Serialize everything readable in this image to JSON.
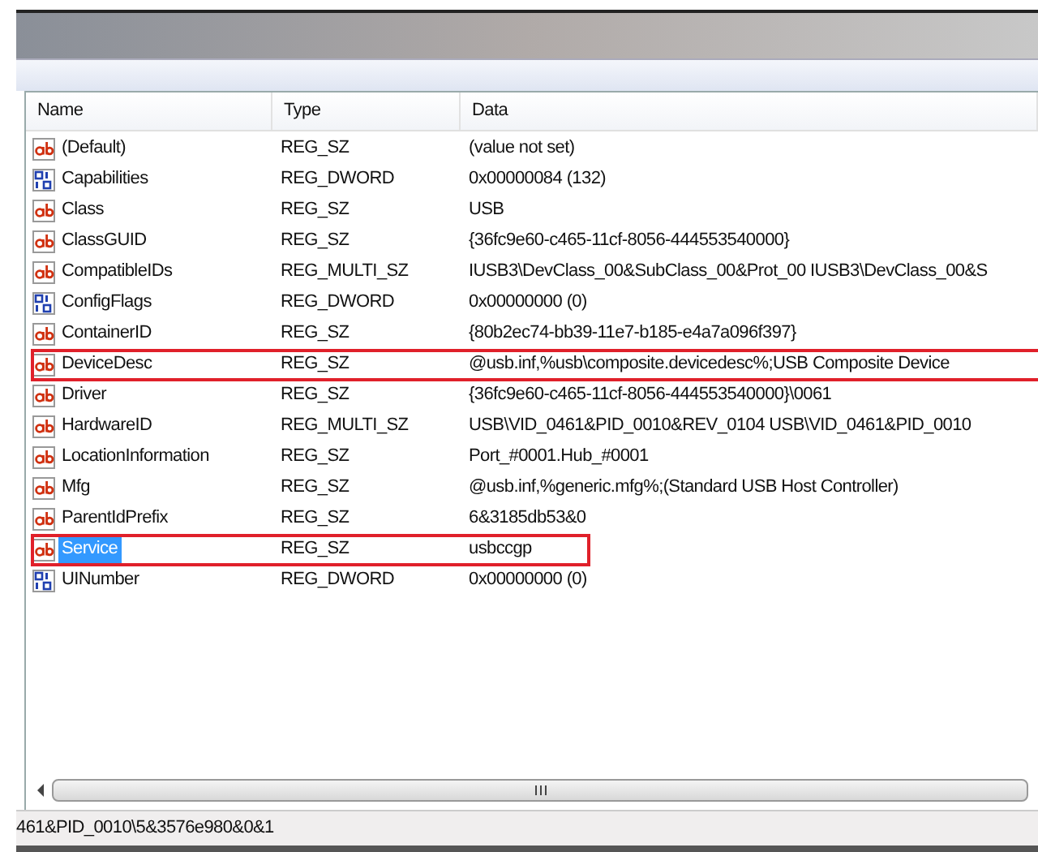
{
  "columns": [
    "Name",
    "Type",
    "Data"
  ],
  "rows": [
    {
      "kind": "string",
      "name": "(Default)",
      "type": "REG_SZ",
      "data": "(value not set)",
      "selected": false,
      "highlighted": false
    },
    {
      "kind": "binary",
      "name": "Capabilities",
      "type": "REG_DWORD",
      "data": "0x00000084 (132)",
      "selected": false,
      "highlighted": false
    },
    {
      "kind": "string",
      "name": "Class",
      "type": "REG_SZ",
      "data": "USB",
      "selected": false,
      "highlighted": false
    },
    {
      "kind": "string",
      "name": "ClassGUID",
      "type": "REG_SZ",
      "data": "{36fc9e60-c465-11cf-8056-444553540000}",
      "selected": false,
      "highlighted": false
    },
    {
      "kind": "string",
      "name": "CompatibleIDs",
      "type": "REG_MULTI_SZ",
      "data": "IUSB3\\DevClass_00&SubClass_00&Prot_00 IUSB3\\DevClass_00&S",
      "selected": false,
      "highlighted": false
    },
    {
      "kind": "binary",
      "name": "ConfigFlags",
      "type": "REG_DWORD",
      "data": "0x00000000 (0)",
      "selected": false,
      "highlighted": false
    },
    {
      "kind": "string",
      "name": "ContainerID",
      "type": "REG_SZ",
      "data": "{80b2ec74-bb39-11e7-b185-e4a7a096f397}",
      "selected": false,
      "highlighted": false
    },
    {
      "kind": "string",
      "name": "DeviceDesc",
      "type": "REG_SZ",
      "data": "@usb.inf,%usb\\composite.devicedesc%;USB Composite Device",
      "selected": false,
      "highlighted": true
    },
    {
      "kind": "string",
      "name": "Driver",
      "type": "REG_SZ",
      "data": "{36fc9e60-c465-11cf-8056-444553540000}\\0061",
      "selected": false,
      "highlighted": false
    },
    {
      "kind": "string",
      "name": "HardwareID",
      "type": "REG_MULTI_SZ",
      "data": "USB\\VID_0461&PID_0010&REV_0104 USB\\VID_0461&PID_0010",
      "selected": false,
      "highlighted": false
    },
    {
      "kind": "string",
      "name": "LocationInformation",
      "type": "REG_SZ",
      "data": "Port_#0001.Hub_#0001",
      "selected": false,
      "highlighted": false
    },
    {
      "kind": "string",
      "name": "Mfg",
      "type": "REG_SZ",
      "data": "@usb.inf,%generic.mfg%;(Standard USB Host Controller)",
      "selected": false,
      "highlighted": false
    },
    {
      "kind": "string",
      "name": "ParentIdPrefix",
      "type": "REG_SZ",
      "data": "6&3185db53&0",
      "selected": false,
      "highlighted": false
    },
    {
      "kind": "string",
      "name": "Service",
      "type": "REG_SZ",
      "data": "usbccgp",
      "selected": true,
      "highlighted": true
    },
    {
      "kind": "binary",
      "name": "UINumber",
      "type": "REG_DWORD",
      "data": "0x00000000 (0)",
      "selected": false,
      "highlighted": false
    }
  ],
  "status_bar": "461&PID_0010\\5&3576e980&0&1"
}
